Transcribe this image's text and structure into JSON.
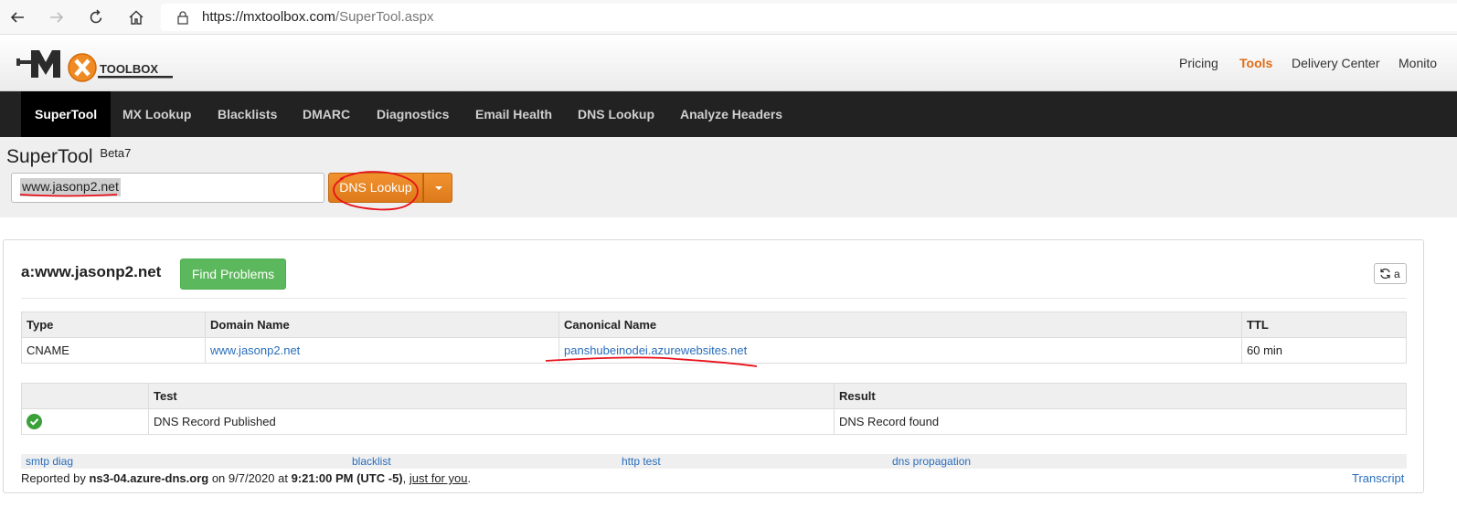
{
  "browser": {
    "url_host": "https://mxtoolbox.com",
    "url_path": "/SuperTool.aspx"
  },
  "header": {
    "logo_text": "TOOLBOX",
    "nav": [
      "Pricing",
      "Tools",
      "Delivery Center",
      "Monito"
    ],
    "active_nav": "Tools"
  },
  "menu": {
    "items": [
      "SuperTool",
      "MX Lookup",
      "Blacklists",
      "DMARC",
      "Diagnostics",
      "Email Health",
      "DNS Lookup",
      "Analyze Headers"
    ],
    "active": "SuperTool"
  },
  "search": {
    "title": "SuperTool",
    "beta": "Beta7",
    "value": "www.jasonp2.net",
    "button_label": "DNS Lookup"
  },
  "result": {
    "title": "a:www.jasonp2.net",
    "find_problems_label": "Find Problems",
    "refresh_label": "a",
    "records_headers": [
      "Type",
      "Domain Name",
      "Canonical Name",
      "TTL"
    ],
    "records": [
      {
        "type": "CNAME",
        "domain": "www.jasonp2.net",
        "canonical": "panshubeinodei.azurewebsites.net",
        "ttl": "60 min"
      }
    ],
    "tests_headers": [
      "",
      "Test",
      "Result"
    ],
    "tests": [
      {
        "status": "ok",
        "test": "DNS Record Published",
        "result": "DNS Record found"
      }
    ],
    "links": [
      "smtp diag",
      "blacklist",
      "http test",
      "dns propagation"
    ],
    "reported_prefix": "Reported by ",
    "reported_server": "ns3-04.azure-dns.org",
    "reported_on": " on 9/7/2020 at ",
    "reported_time": "9:21:00 PM (UTC -5)",
    "reported_sep": ", ",
    "reported_link": "just for you",
    "reported_end": ".",
    "transcript_label": "Transcript"
  },
  "colors": {
    "accent_orange": "#e06c14",
    "menu_bg": "#222222",
    "success_green": "#5cb85c",
    "link_blue": "#2a6ebb",
    "annotation_red": "#e8101a"
  }
}
